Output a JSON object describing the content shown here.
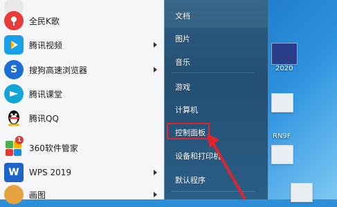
{
  "start_menu": {
    "programs": [
      {
        "label": "",
        "icon": "app-icon",
        "color": "#e8e8e8",
        "has_submenu": false
      },
      {
        "label": "全民K歌",
        "icon": "karaoke-icon",
        "color": "#ea3b3b",
        "has_submenu": false
      },
      {
        "label": "腾讯视频",
        "icon": "tencent-video-icon",
        "color": "#1aa0e8",
        "has_submenu": true
      },
      {
        "label": "搜狗高速浏览器",
        "icon": "sogou-browser-icon",
        "color": "#1b6fd2",
        "has_submenu": true
      },
      {
        "label": "腾讯课堂",
        "icon": "tencent-classroom-icon",
        "color": "#12a6d6",
        "has_submenu": false
      },
      {
        "label": "腾讯QQ",
        "icon": "qq-penguin-icon",
        "color": "#111111",
        "has_submenu": false
      },
      {
        "label": "360软件管家",
        "icon": "360-software-manager-icon",
        "color": "#4caf50",
        "badge": "1",
        "has_submenu": false
      },
      {
        "label": "WPS 2019",
        "icon": "wps-icon",
        "color": "#1e64c8",
        "has_submenu": true
      },
      {
        "label": "画图",
        "icon": "paint-icon",
        "color": "#e6a23c",
        "has_submenu": true
      }
    ],
    "right_items": [
      {
        "label": "文档"
      },
      {
        "label": "图片"
      },
      {
        "label": "音乐"
      },
      {
        "label": "游戏"
      },
      {
        "label": "计算机"
      },
      {
        "label": "控制面板"
      },
      {
        "label": "设备和打印机"
      },
      {
        "label": "默认程序"
      }
    ]
  },
  "desktop": {
    "labels": [
      "2020",
      "RN9F"
    ]
  },
  "colors": {
    "highlight": "#e0232d"
  }
}
